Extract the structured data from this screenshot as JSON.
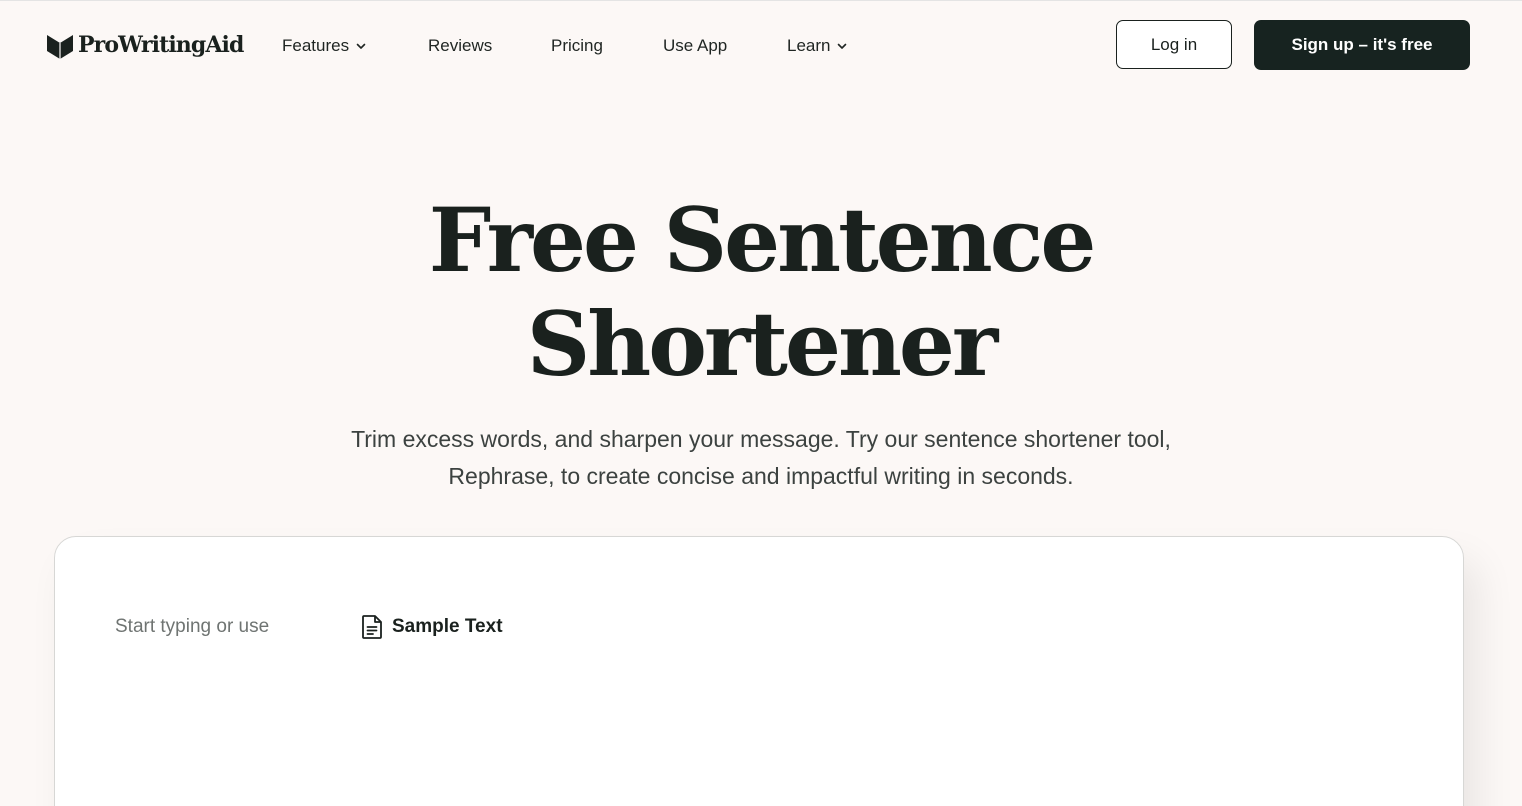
{
  "header": {
    "logo_text": "ProWritingAid",
    "nav": [
      {
        "label": "Features",
        "has_dropdown": true
      },
      {
        "label": "Reviews",
        "has_dropdown": false
      },
      {
        "label": "Pricing",
        "has_dropdown": false
      },
      {
        "label": "Use App",
        "has_dropdown": false
      },
      {
        "label": "Learn",
        "has_dropdown": true
      }
    ],
    "login_label": "Log in",
    "signup_label": "Sign up – it's free"
  },
  "hero": {
    "title_line1": "Free Sentence",
    "title_line2": "Shortener",
    "subtitle_line1": "Trim excess words, and sharpen your message. Try our sentence shortener tool,",
    "subtitle_line2": "Rephrase, to create concise and impactful writing in seconds."
  },
  "editor": {
    "placeholder": "Start typing or use",
    "sample_label": "Sample Text",
    "sample_icon": "document-icon"
  },
  "colors": {
    "background": "#fcf8f6",
    "dark": "#172320",
    "text": "#1a211e"
  }
}
